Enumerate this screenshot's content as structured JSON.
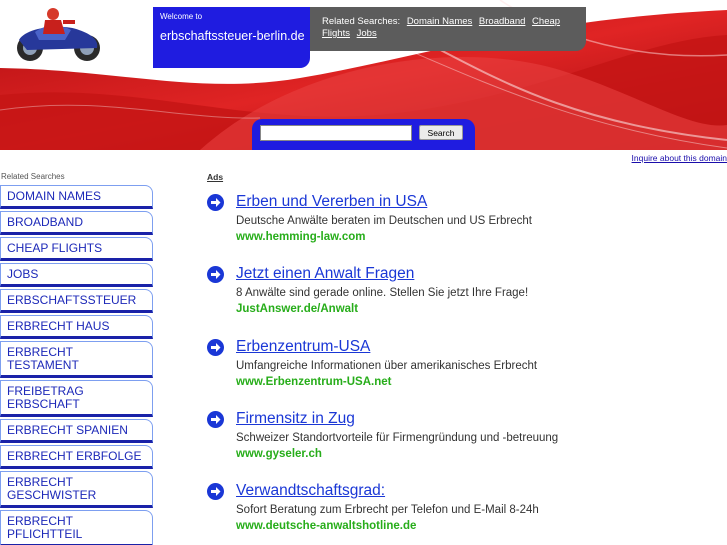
{
  "header": {
    "welcome_label": "Welcome to",
    "domain": "erbschaftssteuer-berlin.de",
    "related_label": "Related Searches:",
    "related_links": [
      "Domain Names",
      "Broadband",
      "Cheap Flights",
      "Jobs"
    ],
    "search_button": "Search",
    "search_value": ""
  },
  "inquire_link": "Inquire about this domain",
  "sidebar": {
    "title": "Related Searches",
    "items": [
      {
        "label": "DOMAIN NAMES"
      },
      {
        "label": "BROADBAND"
      },
      {
        "label": "CHEAP FLIGHTS"
      },
      {
        "label": "JOBS"
      },
      {
        "label": "ERBSCHAFTSSTEUER"
      },
      {
        "label": "ERBRECHT HAUS"
      },
      {
        "label": "ERBRECHT TESTAMENT"
      },
      {
        "label": "FREIBETRAG ERBSCHAFT"
      },
      {
        "label": "ERBRECHT SPANIEN"
      },
      {
        "label": "ERBRECHT ERBFOLGE"
      },
      {
        "label": "ERBRECHT GESCHWISTER"
      },
      {
        "label": "ERBRECHT PFLICHTTEIL"
      }
    ]
  },
  "ads": {
    "label": "Ads",
    "items": [
      {
        "title": "Erben und Vererben in USA",
        "description": "Deutsche Anwälte beraten im Deutschen und US Erbrecht",
        "url": "www.hemming-law.com"
      },
      {
        "title": "Jetzt einen Anwalt Fragen",
        "description": "8 Anwälte sind gerade online. Stellen Sie jetzt Ihre Frage!",
        "url": "JustAnswer.de/Anwalt"
      },
      {
        "title": "Erbenzentrum-USA",
        "description": "Umfangreiche Informationen über amerikanisches Erbrecht",
        "url": "www.Erbenzentrum-USA.net"
      },
      {
        "title": "Firmensitz in Zug",
        "description": "Schweizer Standortvorteile für Firmengründung und -betreuung",
        "url": "www.gyseler.ch"
      },
      {
        "title": "Verwandtschaftsgrad:",
        "description": "Sofort Beratung zum Erbrecht per Telefon und E-Mail 8-24h",
        "url": "www.deutsche-anwaltshotline.de"
      }
    ]
  },
  "colors": {
    "header_blue": "#1f1ce0",
    "header_gray": "#5c5c5c",
    "accent_red": "#cc1a1a",
    "link_blue": "#1a37d6",
    "url_green": "#27ad1a"
  }
}
